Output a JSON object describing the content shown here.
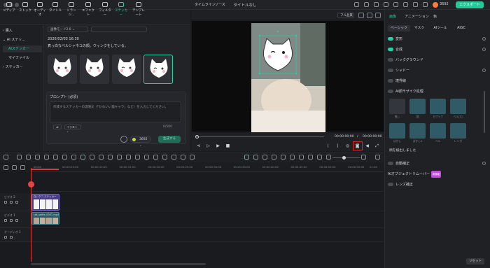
{
  "window": {
    "title": "タイトルなし"
  },
  "header": {
    "credits": "3692",
    "export_label": "エクスポート"
  },
  "top_tabs": [
    {
      "label": "メディア"
    },
    {
      "label": "ストック"
    },
    {
      "label": "オーディオ"
    },
    {
      "label": "タイトル"
    },
    {
      "label": "トランジ..."
    },
    {
      "label": "エフェクト"
    },
    {
      "label": "フィルター"
    },
    {
      "label": "ステッカー"
    },
    {
      "label": "テンプレート"
    }
  ],
  "active_tab": "ステッカー",
  "left_nav": {
    "items": [
      {
        "label": "購入"
      },
      {
        "label": "AI ステッ..."
      },
      {
        "label": "AIステッカー"
      },
      {
        "label": "マイファイル"
      },
      {
        "label": "ステッカー"
      }
    ]
  },
  "sticker_panel": {
    "mode_dropdown": "画像モード2.0",
    "date": "2026/02/03 16:30",
    "description": "真っ白なベルシャネコの顔。ウィンクをしている。",
    "prompt_label": "プロンプト (必須)",
    "prompt_placeholder": "作成するステッカーの説明文（「かわいい猫キャラ」など）を入力してください。",
    "chip_label": "⇄",
    "style_label": "イラスト ⌄",
    "counter": "0/500",
    "credit_cost": "3692 ⌄",
    "generate_label": "生成する"
  },
  "preview": {
    "tabs": [
      {
        "label": "タイムライン"
      },
      {
        "label": "ソース"
      }
    ],
    "quality": "フル品質",
    "time_current": "00:00:00:00",
    "time_separator": "/",
    "time_total": "00:00:00:00"
  },
  "right_panel": {
    "tabs": [
      {
        "label": "画像"
      },
      {
        "label": "アニメーション"
      },
      {
        "label": "色"
      }
    ],
    "subtabs": [
      {
        "label": "ベーシック"
      },
      {
        "label": "マスク"
      },
      {
        "label": "AIツール"
      },
      {
        "label": "AIGC"
      }
    ],
    "rows": [
      {
        "label": "変形",
        "on": true
      },
      {
        "label": "合成",
        "on": true
      },
      {
        "label": "バックグラウンド",
        "on": false
      },
      {
        "label": "シャドー",
        "on": false
      },
      {
        "label": "境界線",
        "on": false
      },
      {
        "label": "AI顔モザイク処理",
        "on": false
      }
    ],
    "mosaic_labels": [
      "無し",
      "顔",
      "モザイク",
      "ベル(大)",
      "ぼかし",
      "ぼかし2",
      "ベル",
      "レンガ"
    ],
    "note": "顔を検出しました",
    "rows2": [
      {
        "label": "自動補正",
        "on": false
      },
      {
        "label": "AIオブジェクトリムーバー",
        "on": false,
        "badge": "新機能"
      },
      {
        "label": "レンズ補正",
        "on": false
      }
    ],
    "reset_label": "リセット"
  },
  "timeline": {
    "ruler_ticks": [
      "00:00",
      "00:00:05:00",
      "00:00:10:00",
      "00:00:15:00",
      "00:00:20:00",
      "00:00:25:00",
      "00:00:30:00",
      "00:00:35:00",
      "00:00:40:00",
      "00:00:45:00",
      "00:00:50:00",
      "00:00:55:00",
      "01:00"
    ],
    "tracks": [
      {
        "name": "ビデオ 2",
        "clip": "白いネコ ステッカー"
      },
      {
        "name": "ビデオ 1",
        "clip": "cat_selfie_0001.mp4"
      },
      {
        "name": "オーディオ 1",
        "clip": ""
      }
    ]
  }
}
